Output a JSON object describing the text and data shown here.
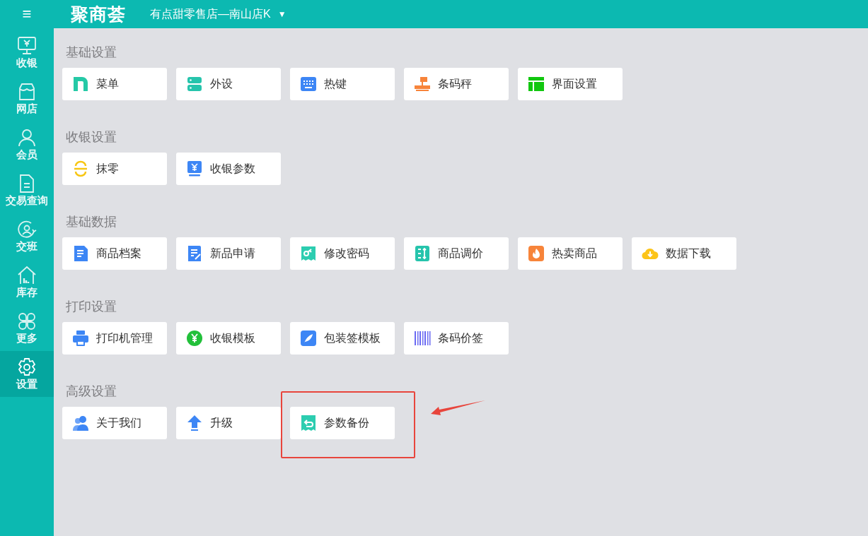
{
  "topbar": {
    "menu_glyph": "≡",
    "logo": "聚商荟",
    "store": "有点甜零售店—南山店K",
    "store_caret": "▼"
  },
  "sidebar": {
    "items": [
      {
        "label": "收银",
        "selected": false
      },
      {
        "label": "网店",
        "selected": false
      },
      {
        "label": "会员",
        "selected": false
      },
      {
        "label": "交易查询",
        "selected": false
      },
      {
        "label": "交班",
        "selected": false
      },
      {
        "label": "库存",
        "selected": false
      },
      {
        "label": "更多",
        "selected": false
      },
      {
        "label": "设置",
        "selected": true
      }
    ]
  },
  "sections": [
    {
      "title": "基础设置",
      "items": [
        {
          "label": "菜单",
          "highlighted": false
        },
        {
          "label": "外设",
          "highlighted": false
        },
        {
          "label": "热键",
          "highlighted": false
        },
        {
          "label": "条码秤",
          "highlighted": false
        },
        {
          "label": "界面设置",
          "highlighted": false
        }
      ]
    },
    {
      "title": "收银设置",
      "items": [
        {
          "label": "抹零",
          "highlighted": false
        },
        {
          "label": "收银参数",
          "highlighted": false
        }
      ]
    },
    {
      "title": "基础数据",
      "items": [
        {
          "label": "商品档案",
          "highlighted": false
        },
        {
          "label": "新品申请",
          "highlighted": false
        },
        {
          "label": "修改密码",
          "highlighted": false
        },
        {
          "label": "商品调价",
          "highlighted": false
        },
        {
          "label": "热卖商品",
          "highlighted": false
        },
        {
          "label": "数据下载",
          "highlighted": false
        }
      ]
    },
    {
      "title": "打印设置",
      "items": [
        {
          "label": "打印机管理",
          "highlighted": false
        },
        {
          "label": "收银模板",
          "highlighted": false
        },
        {
          "label": "包装签模板",
          "highlighted": false
        },
        {
          "label": "条码价签",
          "highlighted": false
        }
      ]
    },
    {
      "title": "高级设置",
      "items": [
        {
          "label": "关于我们",
          "highlighted": false
        },
        {
          "label": "升级",
          "highlighted": false
        },
        {
          "label": "参数备份",
          "highlighted": true
        }
      ]
    }
  ]
}
